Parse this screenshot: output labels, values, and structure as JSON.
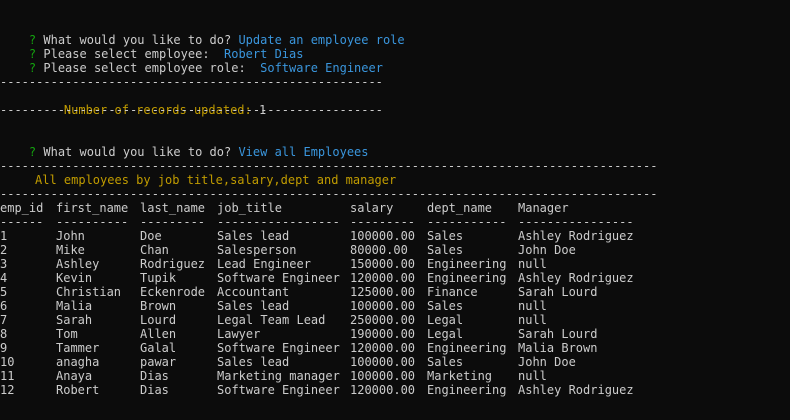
{
  "prompt1": {
    "question_mark": "?",
    "question": "What would you like to do?",
    "answer": "Update an employee role"
  },
  "prompt2": {
    "question_mark": "?",
    "question": "Please select employee:",
    "answer": "Robert Dias"
  },
  "prompt3": {
    "question_mark": "?",
    "question": "Please select employee role:",
    "answer": "Software Engineer"
  },
  "separator_short": "-----------------------------------------------------",
  "records_updated": {
    "label": "Number of records updated:",
    "count": "1"
  },
  "prompt4": {
    "question_mark": "?",
    "question": "What would you like to do?",
    "answer": "View all Employees"
  },
  "separator_long": "-------------------------------------------------------------------------------------------",
  "report_title": "All employees by job title,salary,dept and manager",
  "table": {
    "columns": [
      "emp_id",
      "first_name",
      "last_name",
      "job_title",
      "salary",
      "dept_name",
      "Manager"
    ],
    "underlines": [
      "------",
      "----------",
      "---------",
      "-----------------",
      "---------",
      "-----------",
      "----------------"
    ],
    "rows": [
      [
        "1",
        "John",
        "Doe",
        "Sales lead",
        "100000.00",
        "Sales",
        "Ashley Rodriguez"
      ],
      [
        "2",
        "Mike",
        "Chan",
        "Salesperson",
        "80000.00",
        "Sales",
        "John Doe"
      ],
      [
        "3",
        "Ashley",
        "Rodriguez",
        "Lead Engineer",
        "150000.00",
        "Engineering",
        "null"
      ],
      [
        "4",
        "Kevin",
        "Tupik",
        "Software Engineer",
        "120000.00",
        "Engineering",
        "Ashley Rodriguez"
      ],
      [
        "5",
        "Christian",
        "Eckenrode",
        "Accountant",
        "125000.00",
        "Finance",
        "Sarah Lourd"
      ],
      [
        "6",
        "Malia",
        "Brown",
        "Sales lead",
        "100000.00",
        "Sales",
        "null"
      ],
      [
        "7",
        "Sarah",
        "Lourd",
        "Legal Team Lead",
        "250000.00",
        "Legal",
        "null"
      ],
      [
        "8",
        "Tom",
        "Allen",
        "Lawyer",
        "190000.00",
        "Legal",
        "Sarah Lourd"
      ],
      [
        "9",
        "Tammer",
        "Galal",
        "Software Engineer",
        "120000.00",
        "Engineering",
        "Malia Brown"
      ],
      [
        "10",
        "anagha",
        "pawar",
        "Sales lead",
        "100000.00",
        "Sales",
        "John Doe"
      ],
      [
        "11",
        "Anaya",
        "Dias",
        "Marketing manager",
        "100000.00",
        "Marketing",
        "null"
      ],
      [
        "12",
        "Robert",
        "Dias",
        "Software Engineer",
        "120000.00",
        "Engineering",
        "Ashley Rodriguez"
      ]
    ]
  }
}
